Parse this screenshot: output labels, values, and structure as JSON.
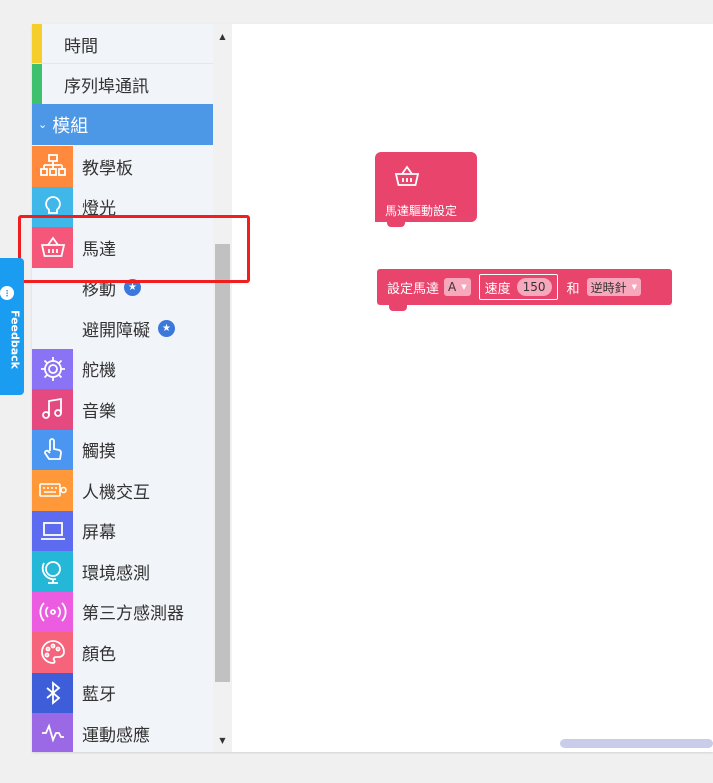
{
  "categories_top": [
    {
      "label": "時間",
      "color": "#f6ce2c"
    },
    {
      "label": "序列埠通訊",
      "color": "#3ec16d"
    }
  ],
  "expanded_category": {
    "label": "模組",
    "caret": "⌄"
  },
  "module_items": [
    {
      "label": "教學板",
      "icon": "network-icon",
      "tile": "#ff8a3d",
      "star": false
    },
    {
      "label": "燈光",
      "icon": "bulb-icon",
      "tile": "#3fb7e8",
      "star": false
    },
    {
      "label": "馬達",
      "icon": "basket-icon",
      "tile": "#f4577a",
      "star": false
    },
    {
      "label": "移動",
      "icon": "",
      "tile": "#f1f4f8",
      "star": true
    },
    {
      "label": "避開障礙",
      "icon": "",
      "tile": "#f1f4f8",
      "star": true
    },
    {
      "label": "舵機",
      "icon": "gear-icon",
      "tile": "#8a73f5",
      "star": false
    },
    {
      "label": "音樂",
      "icon": "music-icon",
      "tile": "#e44a80",
      "star": false
    },
    {
      "label": "觸摸",
      "icon": "finger-icon",
      "tile": "#4a96f0",
      "star": false
    },
    {
      "label": "人機交互",
      "icon": "keyboard-icon",
      "tile": "#ff9838",
      "star": false
    },
    {
      "label": "屏幕",
      "icon": "laptop-icon",
      "tile": "#5d6bf0",
      "star": false
    },
    {
      "label": "環境感測",
      "icon": "globe-icon",
      "tile": "#24b7d8",
      "star": false
    },
    {
      "label": "第三方感測器",
      "icon": "signal-icon",
      "tile": "#ec5ce0",
      "star": false
    },
    {
      "label": "顏色",
      "icon": "palette-icon",
      "tile": "#f5647a",
      "star": false
    },
    {
      "label": "藍牙",
      "icon": "bluetooth-icon",
      "tile": "#3d5ed8",
      "star": false
    },
    {
      "label": "運動感應",
      "icon": "pulse-icon",
      "tile": "#9b69e6",
      "star": false
    }
  ],
  "feedback": {
    "label": "Feedback"
  },
  "hat_block": {
    "label": "馬達驅動設定"
  },
  "command_block": {
    "prefix": "設定馬達",
    "motor": "A",
    "speed_label": "速度",
    "speed_value": "150",
    "and_label": "和",
    "direction": "逆時針"
  },
  "colors": {
    "block": "#e8446c",
    "accent": "#4c97e6",
    "highlight": "#f01e1e"
  }
}
